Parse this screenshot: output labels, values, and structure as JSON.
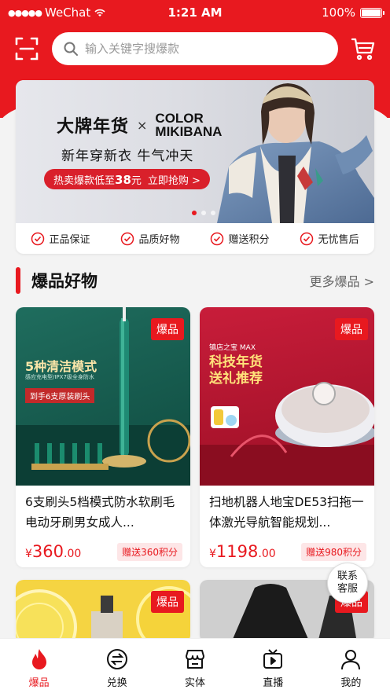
{
  "status_bar": {
    "carrier": "WeChat",
    "time": "1:21 AM",
    "battery": "100%"
  },
  "search": {
    "placeholder": "输入关键字搜爆款"
  },
  "banner": {
    "brand_left": "大牌年货",
    "brand_x": "×",
    "brand_right_1": "COLOR",
    "brand_right_2": "MIKIBANA",
    "slogan": "新年穿新衣 牛气冲天",
    "cta_prefix": "热卖爆款低至",
    "cta_price": "38",
    "cta_unit": "元",
    "cta_action": "立即抢购 >"
  },
  "guarantees": [
    "正品保证",
    "品质好物",
    "赠送积分",
    "无忧售后"
  ],
  "section": {
    "title": "爆品好物",
    "more": "更多爆品 >"
  },
  "products": [
    {
      "tag": "爆品",
      "img_heading": "5种清洁模式",
      "img_sub": "感应充电型/IPX7级全身防水",
      "img_badge": "到手6支原装刷头",
      "title": "6支刷头5档模式防水软刷毛电动牙刷男女成人...",
      "currency": "¥",
      "price_int": "360",
      "price_dec": ".00",
      "points": "赠送360积分"
    },
    {
      "tag": "爆品",
      "img_brand": "镇店之宝",
      "img_model": "MAX",
      "img_heading_1": "科技年货",
      "img_heading_2": "送礼推荐",
      "title": "扫地机器人地宝DE53扫拖一体激光导航智能规划...",
      "currency": "¥",
      "price_int": "1198",
      "price_dec": ".00",
      "points": "赠送980积分"
    },
    {
      "tag": "爆品"
    },
    {
      "tag": "爆品"
    }
  ],
  "contact": {
    "line1": "联系",
    "line2": "客服"
  },
  "tabs": [
    {
      "label": "爆品",
      "icon": "flame-icon"
    },
    {
      "label": "兑换",
      "icon": "exchange-icon"
    },
    {
      "label": "实体",
      "icon": "store-icon"
    },
    {
      "label": "直播",
      "icon": "tv-icon"
    },
    {
      "label": "我的",
      "icon": "user-icon"
    }
  ],
  "colors": {
    "accent": "#e8191f",
    "background": "#f3f3f3"
  }
}
